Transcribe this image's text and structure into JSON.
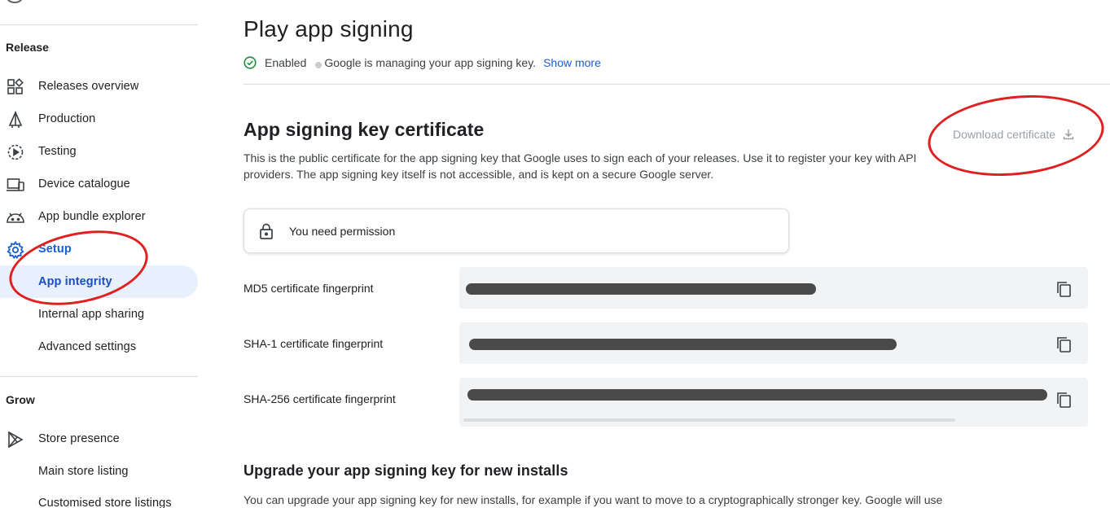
{
  "sidebar": {
    "sections": {
      "release": "Release",
      "grow": "Grow"
    },
    "items": [
      {
        "label": "Releases overview",
        "icon": "dashboard-icon"
      },
      {
        "label": "Production",
        "icon": "production-icon"
      },
      {
        "label": "Testing",
        "icon": "testing-icon"
      },
      {
        "label": "Device catalogue",
        "icon": "devices-icon"
      },
      {
        "label": "App bundle explorer",
        "icon": "android-icon"
      },
      {
        "label": "Setup",
        "icon": "gear-icon"
      },
      {
        "label": "App integrity",
        "icon": ""
      },
      {
        "label": "Internal app sharing",
        "icon": ""
      },
      {
        "label": "Advanced settings",
        "icon": ""
      },
      {
        "label": "Store presence",
        "icon": "play-icon"
      },
      {
        "label": "Main store listing",
        "icon": ""
      },
      {
        "label": "Customised store listings",
        "icon": ""
      }
    ]
  },
  "header": {
    "title": "Play app signing",
    "status": "Enabled",
    "status_detail": "Google is managing your app signing key.",
    "show_more": "Show more"
  },
  "certificate": {
    "title": "App signing key certificate",
    "description": "This is the public certificate for the app signing key that Google uses to sign each of your releases. Use it to register your key with API providers. The app signing key itself is not accessible, and is kept on a secure Google server.",
    "download_label": "Download certificate",
    "permission_text": "You need permission",
    "fingerprints": [
      {
        "label": "MD5 certificate fingerprint"
      },
      {
        "label": "SHA-1 certificate fingerprint"
      },
      {
        "label": "SHA-256 certificate fingerprint"
      }
    ]
  },
  "upgrade": {
    "title": "Upgrade your app signing key for new installs",
    "description": "You can upgrade your app signing key for new installs, for example if you want to move to a cryptographically stronger key. Google will use"
  },
  "colors": {
    "accent": "#1a5fd2",
    "active_bg": "#e8f0fe",
    "success": "#1e8e3e",
    "annotation": "#e02020"
  }
}
